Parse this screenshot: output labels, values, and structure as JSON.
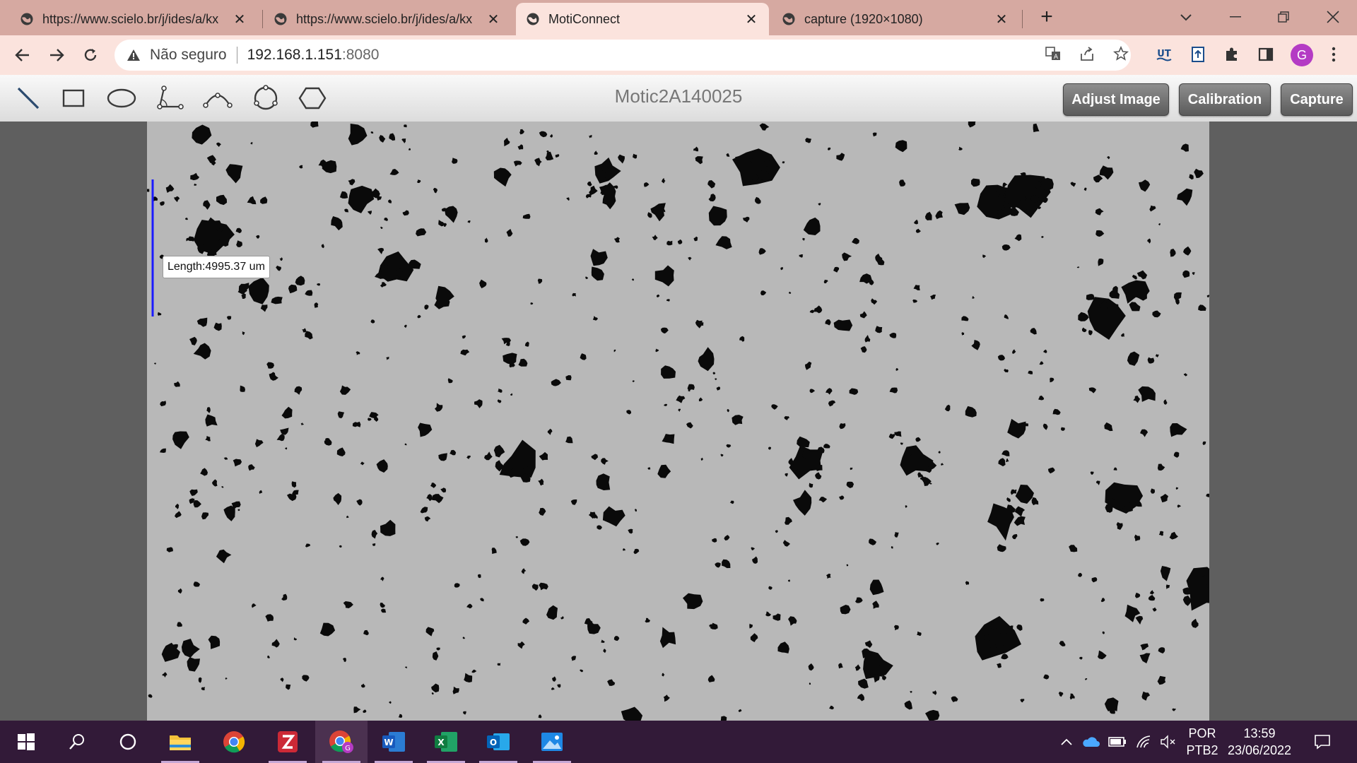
{
  "browser": {
    "tabs": [
      {
        "title": "https://www.scielo.br/j/ides/a/kx",
        "active": false
      },
      {
        "title": "https://www.scielo.br/j/ides/a/kx",
        "active": false
      },
      {
        "title": "MotiConnect",
        "active": true
      },
      {
        "title": "capture (1920×1080)",
        "active": false
      }
    ],
    "new_tab_symbol": "+",
    "security_text": "Não seguro",
    "url_host": "192.168.1.151",
    "url_port": ":8080",
    "avatar_letter": "G"
  },
  "app": {
    "device_name": "Motic2A140025",
    "tools": [
      "line-tool-icon",
      "rectangle-tool-icon",
      "ellipse-tool-icon",
      "angle-tool-icon",
      "arc-tool-icon",
      "circle-tool-icon",
      "polygon-tool-icon"
    ],
    "buttons": {
      "adjust": "Adjust Image",
      "calibration": "Calibration",
      "capture": "Capture"
    },
    "measurement": {
      "label": "Length:4995.37 um",
      "line_color": "#1a1aff"
    }
  },
  "taskbar": {
    "apps": [
      "windows-start-icon",
      "search-icon",
      "cortana-icon",
      "file-explorer-icon",
      "chrome-icon",
      "zotero-icon",
      "chrome-profile-icon",
      "word-icon",
      "excel-icon",
      "outlook-icon",
      "photos-icon"
    ],
    "language_top": "POR",
    "language_bottom": "PTB2",
    "time": "13:59",
    "date": "23/06/2022"
  },
  "colors": {
    "tabbar_bg": "#d6a9a1",
    "toolbar_bg": "#fbe3dd",
    "taskbar_bg": "#321a38",
    "button_gray": "#6f6f6f"
  }
}
